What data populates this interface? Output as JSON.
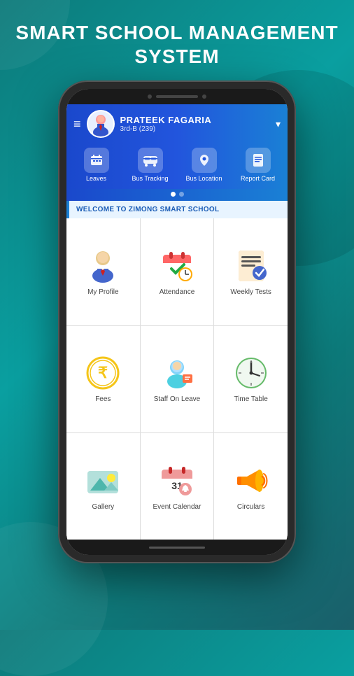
{
  "page": {
    "title_line1": "SMART SCHOOL MANAGEMENT",
    "title_line2": "SYSTEM"
  },
  "header": {
    "user_name": "PRATEEK FAGARIA",
    "user_class": "3rd-B (239)",
    "hamburger_label": "≡",
    "dropdown_arrow": "▾"
  },
  "quick_nav": {
    "items": [
      {
        "id": "leaves",
        "label": "Leaves",
        "icon": "📅"
      },
      {
        "id": "bus-tracking",
        "label": "Bus Tracking",
        "icon": "🚌"
      },
      {
        "id": "bus-location",
        "label": "Bus Location",
        "icon": "📍"
      },
      {
        "id": "report-card",
        "label": "Report Card",
        "icon": "📋"
      }
    ]
  },
  "dots": {
    "items": [
      {
        "active": true
      },
      {
        "active": false
      }
    ]
  },
  "welcome": {
    "text": "WELCOME TO ZIMONG SMART SCHOOL"
  },
  "menu": {
    "items": [
      {
        "id": "my-profile",
        "label": "My Profile",
        "icon": "👨‍💼"
      },
      {
        "id": "attendance",
        "label": "Attendance",
        "icon": "📆"
      },
      {
        "id": "weekly-tests",
        "label": "Weekly Tests",
        "icon": "📝"
      },
      {
        "id": "fees",
        "label": "Fees",
        "icon": "₹"
      },
      {
        "id": "staff-on-leave",
        "label": "Staff On Leave",
        "icon": "👤"
      },
      {
        "id": "time-table",
        "label": "Time Table",
        "icon": "🗓"
      },
      {
        "id": "gallery",
        "label": "Gallery",
        "icon": "🖼"
      },
      {
        "id": "event-calendar",
        "label": "Event Calendar",
        "icon": "📅"
      },
      {
        "id": "circulars",
        "label": "Circulars",
        "icon": "📢"
      }
    ]
  }
}
